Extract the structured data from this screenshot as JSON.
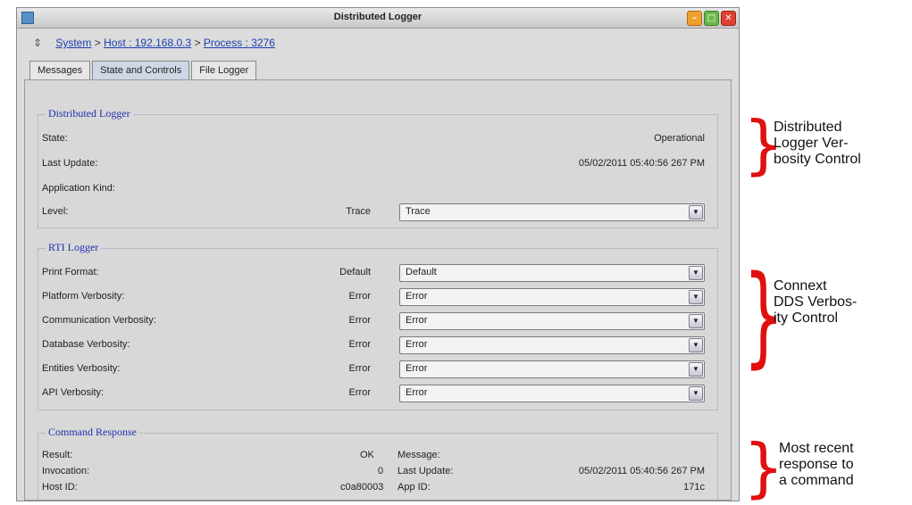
{
  "window": {
    "title": "Distributed Logger"
  },
  "breadcrumb": {
    "system": "System",
    "sep1": ">",
    "host": "Host : 192.168.0.3",
    "sep2": ">",
    "process": "Process : 3276"
  },
  "tabs": [
    "Messages",
    "State and Controls",
    "File Logger"
  ],
  "distributed_logger": {
    "legend": "Distributed Logger",
    "state_label": "State:",
    "state_value": "Operational",
    "last_update_label": "Last Update:",
    "last_update_value": "05/02/2011 05:40:56 267 PM",
    "app_kind_label": "Application Kind:",
    "level_label": "Level:",
    "level_value": "Trace",
    "level_select": "Trace"
  },
  "rti_logger": {
    "legend": "RTI Logger",
    "rows": [
      {
        "label": "Print Format:",
        "value": "Default",
        "select": "Default"
      },
      {
        "label": "Platform Verbosity:",
        "value": "Error",
        "select": "Error"
      },
      {
        "label": "Communication Verbosity:",
        "value": "Error",
        "select": "Error"
      },
      {
        "label": "Database Verbosity:",
        "value": "Error",
        "select": "Error"
      },
      {
        "label": "Entities Verbosity:",
        "value": "Error",
        "select": "Error"
      },
      {
        "label": "API Verbosity:",
        "value": "Error",
        "select": "Error"
      }
    ]
  },
  "command_response": {
    "legend": "Command Response",
    "result_label": "Result:",
    "result_value": "OK",
    "message_label": "Message:",
    "invocation_label": "Invocation:",
    "invocation_value": "0",
    "last_update_label": "Last Update:",
    "last_update_value": "05/02/2011 05:40:56 267 PM",
    "host_id_label": "Host ID:",
    "host_id_value": "c0a80003",
    "app_id_label": "App ID:",
    "app_id_value": "171c"
  },
  "annotations": {
    "a1": [
      "Distributed",
      "Logger Ver-",
      "bosity Control"
    ],
    "a2": [
      "Connext",
      "DDS Verbos-",
      "ity Control"
    ],
    "a3": [
      "Most recent",
      "response to",
      "a command"
    ]
  },
  "colors": {
    "bracket": "#e01010",
    "legend_text": "#2030b0",
    "link": "#1a3fb0"
  }
}
